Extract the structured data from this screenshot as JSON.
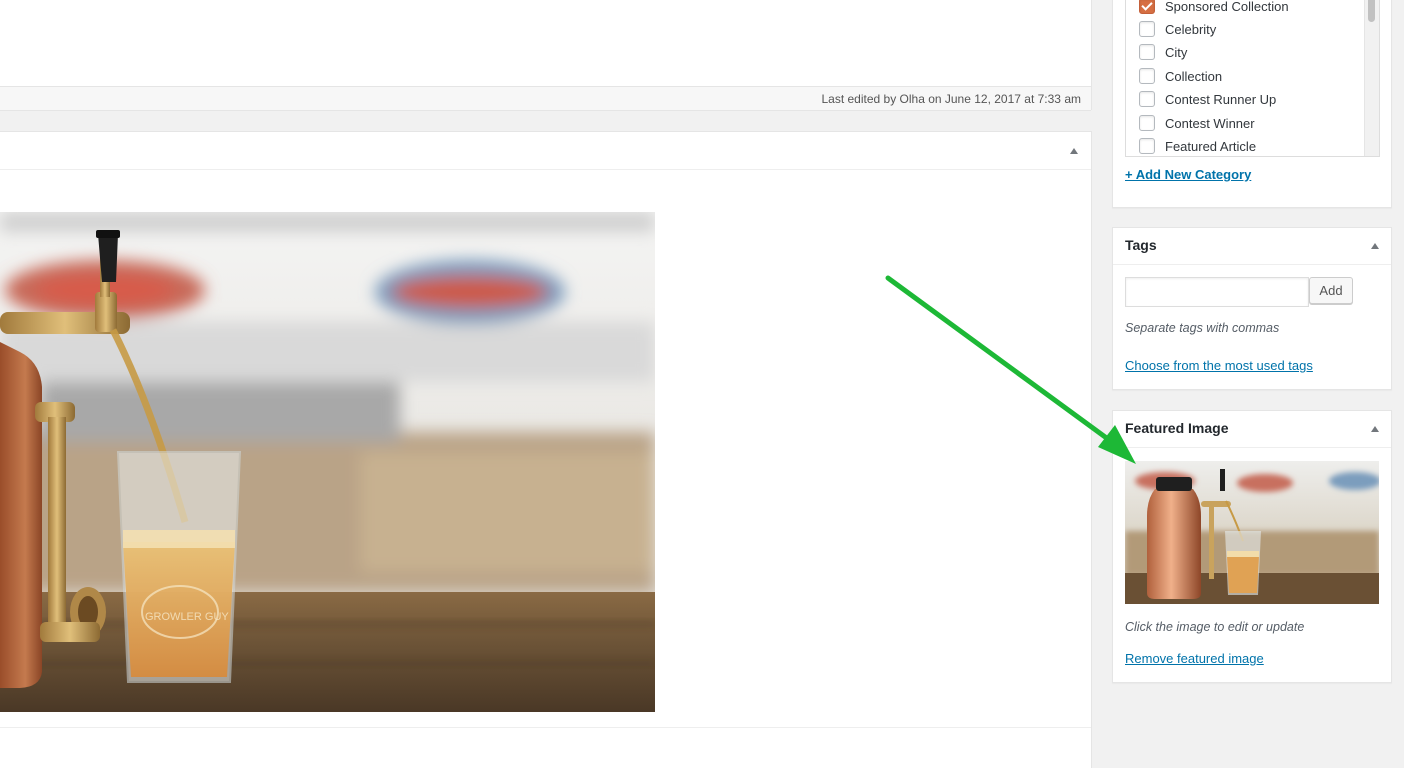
{
  "editor": {
    "last_edited": "Last edited by Olha on June 12, 2017 at 7:33 am"
  },
  "categories": {
    "items": [
      {
        "label": "Sponsored Collection",
        "checked": true
      },
      {
        "label": "Celebrity",
        "checked": false
      },
      {
        "label": "City",
        "checked": false
      },
      {
        "label": "Collection",
        "checked": false
      },
      {
        "label": "Contest Runner Up",
        "checked": false
      },
      {
        "label": "Contest Winner",
        "checked": false
      },
      {
        "label": "Featured Article",
        "checked": false
      }
    ],
    "add_new_link": "+ Add New Category"
  },
  "tags": {
    "title": "Tags",
    "input_value": "",
    "add_button": "Add",
    "hint": "Separate tags with commas",
    "choose_link": "Choose from the most used tags"
  },
  "featured_image": {
    "title": "Featured Image",
    "hint": "Click the image to edit or update",
    "remove_link": "Remove featured image",
    "image_subject": "copper growler with beer tap pouring into pint glass"
  },
  "colors": {
    "link": "#0073aa",
    "checkbox_checked": "#d66f43",
    "annotation_arrow": "#1db836"
  },
  "icons": {
    "collapse_toggle": "triangle-up-icon",
    "checkmark": "checkmark-icon"
  }
}
